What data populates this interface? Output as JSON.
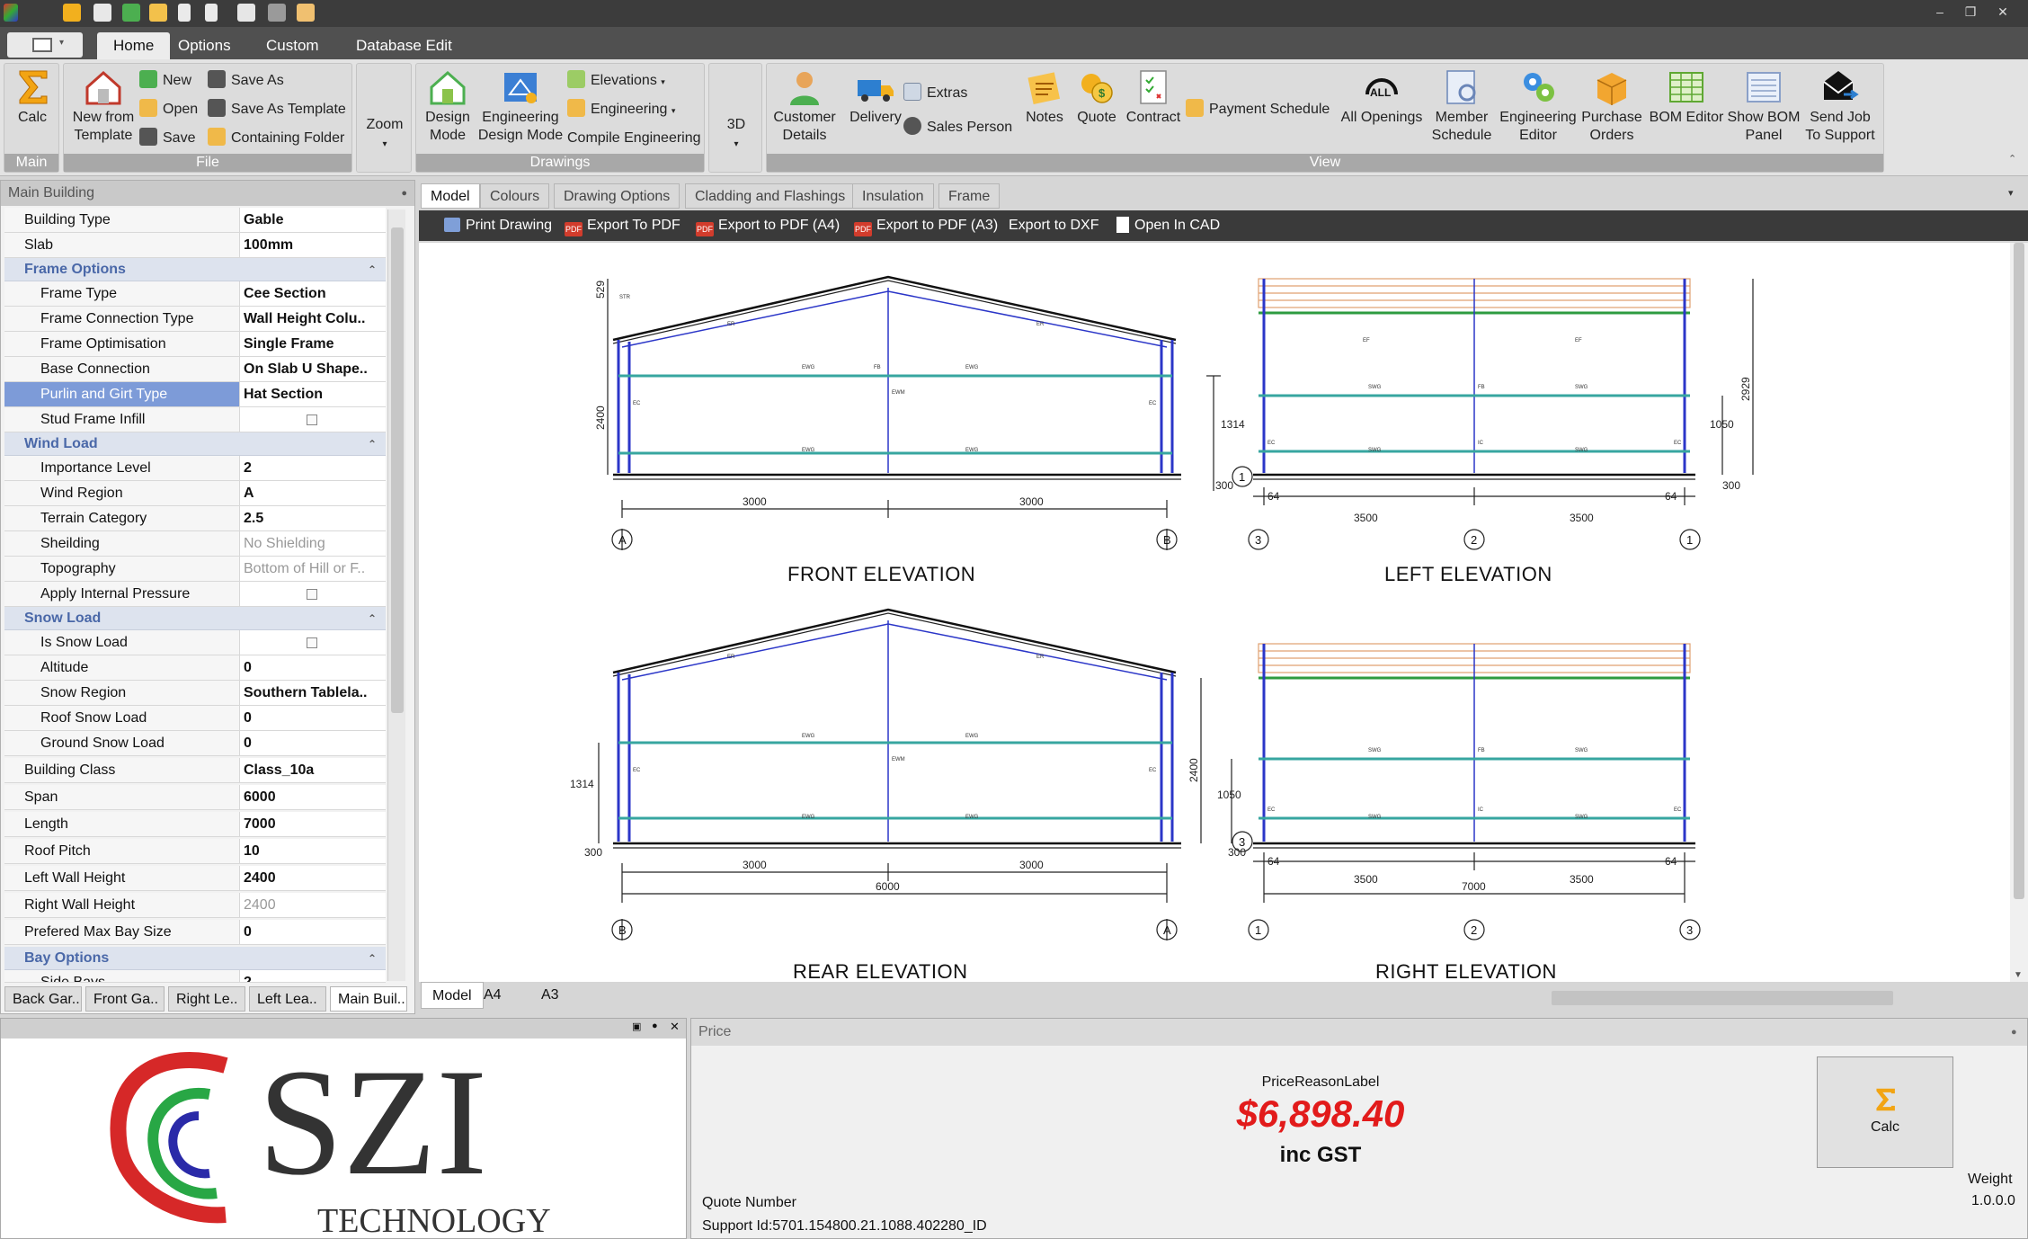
{
  "ribbon": {
    "tabs": [
      "Home",
      "Options",
      "Custom",
      "Database Edit"
    ],
    "active_tab": "Home",
    "groups": {
      "main": {
        "label": "Main",
        "calc": "Calc"
      },
      "file": {
        "label": "File",
        "new_from_template_1": "New from",
        "new_from_template_2": "Template",
        "new": "New",
        "open": "Open",
        "save": "Save",
        "save_as": "Save As",
        "save_as_template": "Save As Template",
        "containing_folder": "Containing Folder"
      },
      "zoom": {
        "label": "Zoom"
      },
      "drawings": {
        "label": "Drawings",
        "design_mode_1": "Design",
        "design_mode_2": "Mode",
        "eng_design_mode_1": "Engineering",
        "eng_design_mode_2": "Design Mode",
        "elevations": "Elevations",
        "engineering": "Engineering",
        "compile_engineering": "Compile Engineering"
      },
      "three_d": {
        "label": "3D"
      },
      "view": {
        "label": "View",
        "customer_details_1": "Customer",
        "customer_details_2": "Details",
        "delivery": "Delivery",
        "extras": "Extras",
        "sales_person": "Sales Person",
        "notes": "Notes",
        "quote": "Quote",
        "contract": "Contract",
        "payment_schedule": "Payment Schedule",
        "all_openings": "All Openings",
        "member_schedule_1": "Member",
        "member_schedule_2": "Schedule",
        "engineering_editor_1": "Engineering",
        "engineering_editor_2": "Editor",
        "purchase_orders_1": "Purchase",
        "purchase_orders_2": "Orders",
        "bom_editor": "BOM Editor",
        "show_bom_panel_1": "Show BOM",
        "show_bom_panel_2": "Panel",
        "send_job_1": "Send Job",
        "send_job_2": "To Support",
        "all_icon_text": "ALL"
      }
    }
  },
  "props": {
    "header": "Main Building",
    "building_type": {
      "name": "Building Type",
      "value": "Gable"
    },
    "slab": {
      "name": "Slab",
      "value": "100mm"
    },
    "frame_options": "Frame Options",
    "frame_type": {
      "name": "Frame Type",
      "value": "Cee Section"
    },
    "frame_connection": {
      "name": "Frame Connection Type",
      "value": "Wall Height Colu.."
    },
    "frame_optimisation": {
      "name": "Frame Optimisation",
      "value": "Single Frame"
    },
    "base_connection": {
      "name": "Base Connection",
      "value": "On Slab U Shape.."
    },
    "purlin_girt": {
      "name": "Purlin and Girt Type",
      "value": "Hat Section"
    },
    "stud_frame": {
      "name": "Stud Frame Infill"
    },
    "wind_load": "Wind Load",
    "importance": {
      "name": "Importance Level",
      "value": "2"
    },
    "wind_region": {
      "name": "Wind Region",
      "value": "A"
    },
    "terrain": {
      "name": "Terrain Category",
      "value": "2.5"
    },
    "shielding": {
      "name": "Sheilding",
      "value": "No Shielding"
    },
    "topography": {
      "name": "Topography",
      "value": "Bottom of Hill or F.."
    },
    "apply_internal": {
      "name": "Apply Internal Pressure"
    },
    "snow_load": "Snow Load",
    "is_snow": {
      "name": "Is Snow Load"
    },
    "altitude": {
      "name": "Altitude",
      "value": "0"
    },
    "snow_region": {
      "name": "Snow Region",
      "value": "Southern Tablela.."
    },
    "roof_snow": {
      "name": "Roof Snow Load",
      "value": "0"
    },
    "ground_snow": {
      "name": "Ground Snow Load",
      "value": "0"
    },
    "building_class": {
      "name": "Building Class",
      "value": "Class_10a"
    },
    "span": {
      "name": "Span",
      "value": "6000"
    },
    "length": {
      "name": "Length",
      "value": "7000"
    },
    "roof_pitch": {
      "name": "Roof Pitch",
      "value": "10"
    },
    "left_wall": {
      "name": "Left Wall Height",
      "value": "2400"
    },
    "right_wall": {
      "name": "Right Wall Height",
      "value": "2400"
    },
    "max_bay": {
      "name": "Prefered Max Bay Size",
      "value": "0"
    },
    "bay_options": "Bay Options",
    "side_bays": {
      "name": "Side Bays",
      "value": "2"
    },
    "bottom_tabs": [
      "Back Gar..",
      "Front Ga..",
      "Right Le..",
      "Left Lea..",
      "Main Buil.."
    ]
  },
  "drawing": {
    "tabs": [
      "Model",
      "Colours",
      "Drawing Options",
      "Cladding and Flashings",
      "Insulation",
      "Frame"
    ],
    "toolbar": {
      "print": "Print Drawing",
      "export_pdf": "Export To PDF",
      "export_a4": "Export to PDF (A4)",
      "export_a3": "Export to PDF (A3)",
      "export_dxf": "Export to DXF",
      "open_cad": "Open In CAD",
      "pdf_badge": "PDF"
    },
    "page_tabs": [
      "Model",
      "A4",
      "A3"
    ],
    "elevations": {
      "front": "FRONT ELEVATION",
      "left": "LEFT ELEVATION",
      "rear": "REAR ELEVATION",
      "right": "RIGHT ELEVATION"
    },
    "dims": {
      "d529": "529",
      "d2400": "2400",
      "d1314": "1314",
      "d300": "300",
      "d3000": "3000",
      "d2929": "2929",
      "d1050": "1050",
      "d64": "64",
      "d3500": "3500",
      "d6000": "6000",
      "d7000": "7000"
    },
    "grid": {
      "A": "A",
      "B": "B",
      "g1": "1",
      "g2": "2",
      "g3": "3"
    },
    "member_tags": {
      "ER": "ER",
      "EWG": "EWG",
      "FB": "FB",
      "EC": "EC",
      "EWM": "EWM",
      "EF": "EF",
      "SWG": "SWG",
      "IC": "IC",
      "STR": "STR"
    }
  },
  "logo": {
    "big": "SZI",
    "small": "TECHNOLOGY"
  },
  "price": {
    "header": "Price",
    "reason_label": "PriceReasonLabel",
    "amount": "$6,898.40",
    "inc_gst": "inc GST",
    "quote_number": "Quote Number",
    "support_id": "Support Id:5701.154800.21.1088.402280_ID",
    "calc": "Calc",
    "weight": "Weight",
    "version": "1.0.0.0"
  },
  "colors": {
    "price_red": "#e21b1b",
    "frame_blue": "#2b36c8",
    "girt_teal": "#37a6a0",
    "selected_row": "#7d9bd8"
  }
}
